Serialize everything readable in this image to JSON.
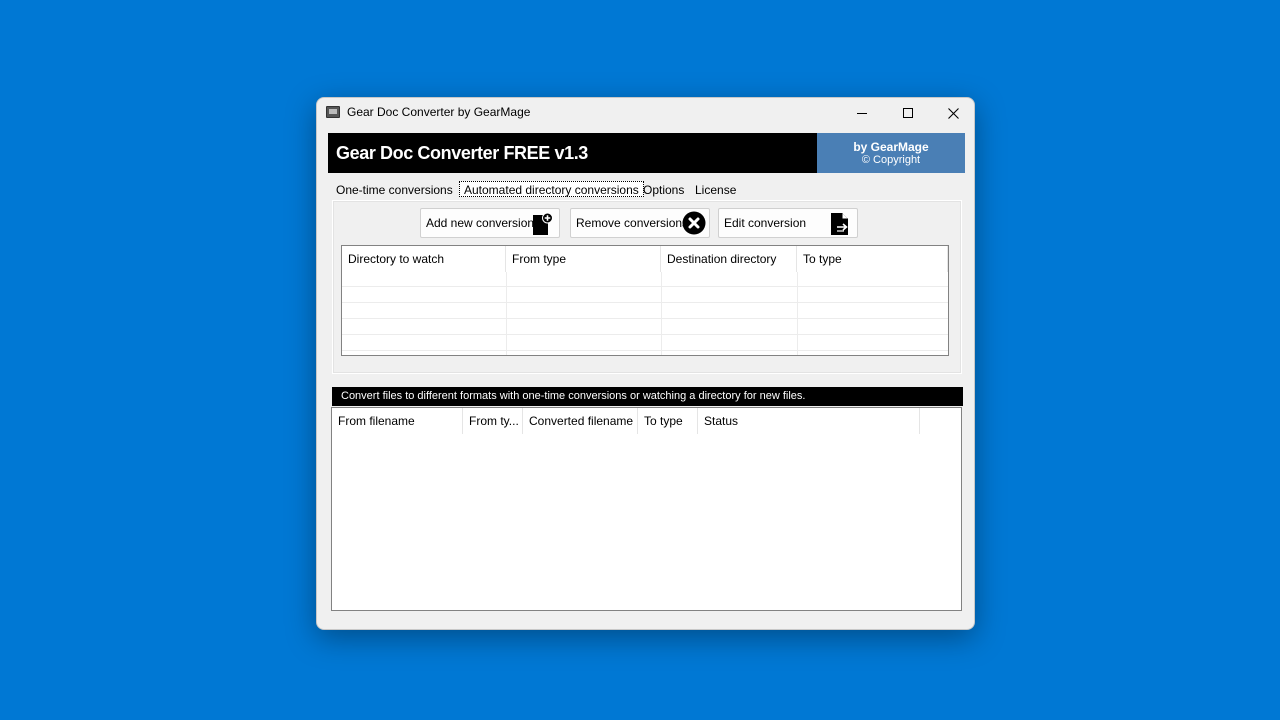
{
  "window": {
    "title": "Gear Doc Converter by GearMage",
    "icons": {
      "app": "app-window-icon",
      "minimize": "minimize-icon",
      "maximize": "maximize-icon",
      "close": "close-icon"
    }
  },
  "banner": {
    "title": "Gear Doc Converter FREE v1.3",
    "byline": "by GearMage",
    "copyright": "© Copyright",
    "byline_color": "#4a7fb5"
  },
  "tabs": [
    {
      "label": "One-time conversions"
    },
    {
      "label": "Automated directory conversions",
      "active": true
    },
    {
      "label": "Options"
    },
    {
      "label": "License"
    }
  ],
  "toolbar": {
    "add_label": "Add new conversion",
    "remove_label": "Remove conversions",
    "edit_label": "Edit conversion"
  },
  "directory_table": {
    "columns": [
      "Directory to watch",
      "From type",
      "Destination directory",
      "To type"
    ],
    "rows": []
  },
  "status_message": "Convert files to different formats with one-time conversions or watching a directory for new files.",
  "log_table": {
    "columns": [
      "From filename",
      "From ty...",
      "Converted filename",
      "To type",
      "Status"
    ],
    "rows": []
  }
}
